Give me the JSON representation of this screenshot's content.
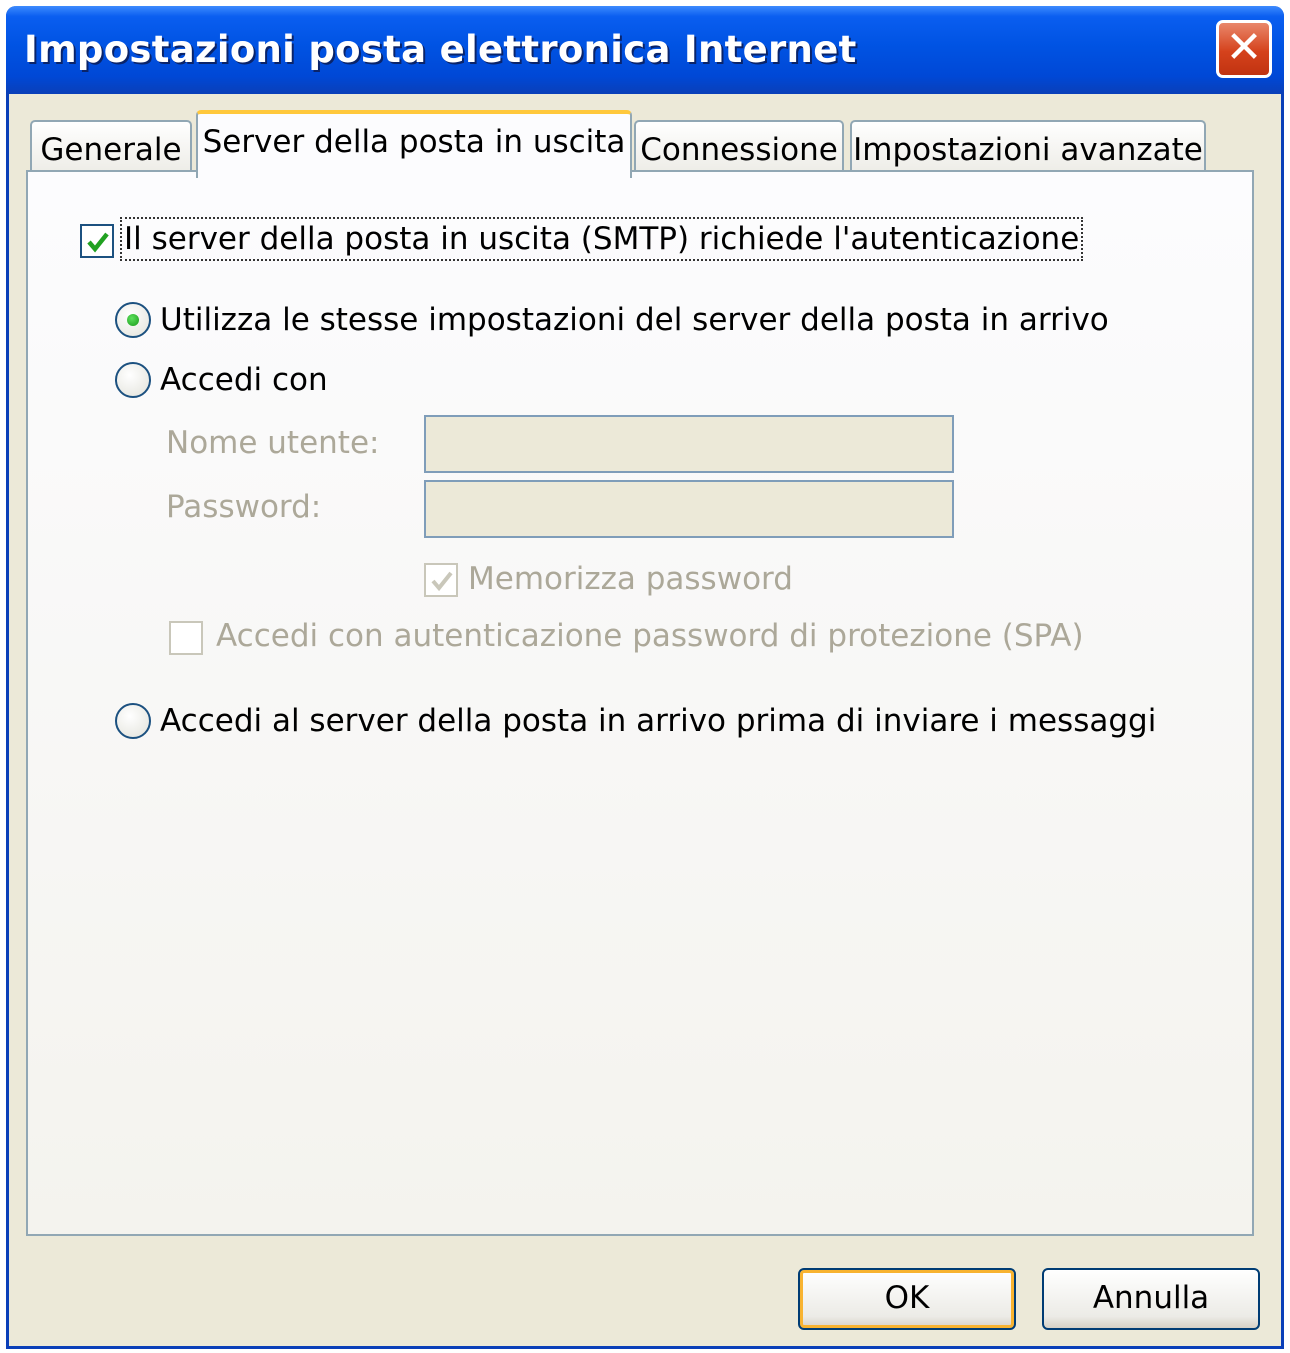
{
  "window": {
    "title": "Impostazioni posta elettronica Internet",
    "close_glyph": "✕"
  },
  "tabs": [
    {
      "label": "Generale",
      "active": false
    },
    {
      "label": "Server della posta in uscita",
      "active": true
    },
    {
      "label": "Connessione",
      "active": false
    },
    {
      "label": "Impostazioni avanzate",
      "active": false
    }
  ],
  "smtp_auth": {
    "label": "Il server della posta in uscita (SMTP) richiede l'autenticazione",
    "checked": true
  },
  "options": {
    "same_settings": {
      "label": "Utilizza le stesse impostazioni del server della posta in arrivo",
      "selected": true
    },
    "login_with": {
      "label": "Accedi con",
      "selected": false
    },
    "login_before_send": {
      "label": "Accedi al server della posta in arrivo prima di inviare i messaggi",
      "selected": false
    }
  },
  "credentials": {
    "username_label": "Nome utente:",
    "username_value": "",
    "password_label": "Password:",
    "password_value": "",
    "remember_password": {
      "label": "Memorizza password",
      "checked": true,
      "disabled": true
    },
    "spa": {
      "label": "Accedi con autenticazione password di protezione (SPA)",
      "checked": false,
      "disabled": true
    }
  },
  "buttons": {
    "ok": "OK",
    "cancel": "Annulla"
  },
  "colors": {
    "title_bar": "#0053e3",
    "dialog_bg": "#ece9d8",
    "check_green": "#21a121",
    "default_button_ring": "#f8b330"
  }
}
